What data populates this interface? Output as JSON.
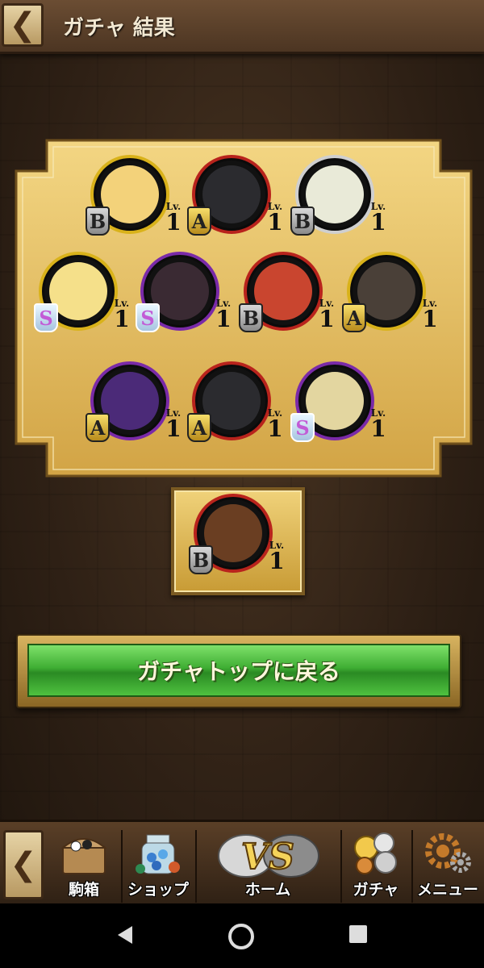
{
  "header": {
    "back_icon": "chevron-left-icon",
    "title": "ガチャ 結果"
  },
  "results": {
    "units": [
      {
        "rank": "B",
        "lv_label": "Lv.",
        "level": "1",
        "color": "#f3d27a",
        "ring": "#d9b21a"
      },
      {
        "rank": "A",
        "lv_label": "Lv.",
        "level": "1",
        "color": "#2b2b2f",
        "ring": "#b8231c"
      },
      {
        "rank": "B",
        "lv_label": "Lv.",
        "level": "1",
        "color": "#e9ead8",
        "ring": "#cfcfcf"
      },
      {
        "rank": "S",
        "lv_label": "Lv.",
        "level": "1",
        "color": "#f5e08a",
        "ring": "#d9b21a"
      },
      {
        "rank": "S",
        "lv_label": "Lv.",
        "level": "1",
        "color": "#3a2a33",
        "ring": "#7a2aa8"
      },
      {
        "rank": "B",
        "lv_label": "Lv.",
        "level": "1",
        "color": "#c9452f",
        "ring": "#b8231c"
      },
      {
        "rank": "A",
        "lv_label": "Lv.",
        "level": "1",
        "color": "#4a4038",
        "ring": "#d9b21a"
      },
      {
        "rank": "A",
        "lv_label": "Lv.",
        "level": "1",
        "color": "#4b2a78",
        "ring": "#7a2aa8"
      },
      {
        "rank": "A",
        "lv_label": "Lv.",
        "level": "1",
        "color": "#2b2b2f",
        "ring": "#b8231c"
      },
      {
        "rank": "S",
        "lv_label": "Lv.",
        "level": "1",
        "color": "#e3d6a0",
        "ring": "#7a2aa8"
      }
    ],
    "bonus_unit": {
      "rank": "B",
      "lv_label": "Lv.",
      "level": "1",
      "color": "#6a3e22",
      "ring": "#b8231c"
    }
  },
  "actions": {
    "back_to_gacha_top": "ガチャトップに戻る"
  },
  "nav": {
    "back_icon": "chevron-left-icon",
    "items": [
      {
        "label": "駒箱",
        "icon": "treasure-chest-icon"
      },
      {
        "label": "ショップ",
        "icon": "jar-of-orbs-icon"
      },
      {
        "label": "ホーム",
        "icon": "vs-emblem-icon"
      },
      {
        "label": "ガチャ",
        "icon": "coins-icon"
      },
      {
        "label": "メニュー",
        "icon": "gears-icon"
      }
    ]
  },
  "system_bar": {
    "back": "back-triangle-icon",
    "home": "home-circle-icon",
    "recents": "recents-square-icon"
  }
}
